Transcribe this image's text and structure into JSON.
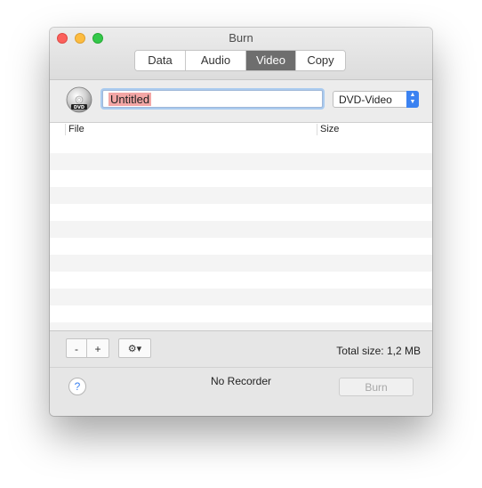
{
  "window": {
    "title": "Burn"
  },
  "tabs": [
    {
      "label": "Data"
    },
    {
      "label": "Audio"
    },
    {
      "label": "Video",
      "active": true
    },
    {
      "label": "Copy"
    }
  ],
  "disc": {
    "icon": "dvd-disc-icon",
    "name": "Untitled"
  },
  "format": {
    "selected": "DVD-Video"
  },
  "table": {
    "columns": [
      "File",
      "Size"
    ],
    "rows": []
  },
  "toolbar": {
    "remove_label": "-",
    "add_label": "+",
    "gear_label": "⚙▾"
  },
  "total_size": "Total size: 1,2 MB",
  "status": {
    "recorder": "No Recorder"
  },
  "help_label": "?",
  "burn_label": "Burn",
  "colors": {
    "accent": "#3b82f1",
    "selection": "#f3a6a5"
  }
}
